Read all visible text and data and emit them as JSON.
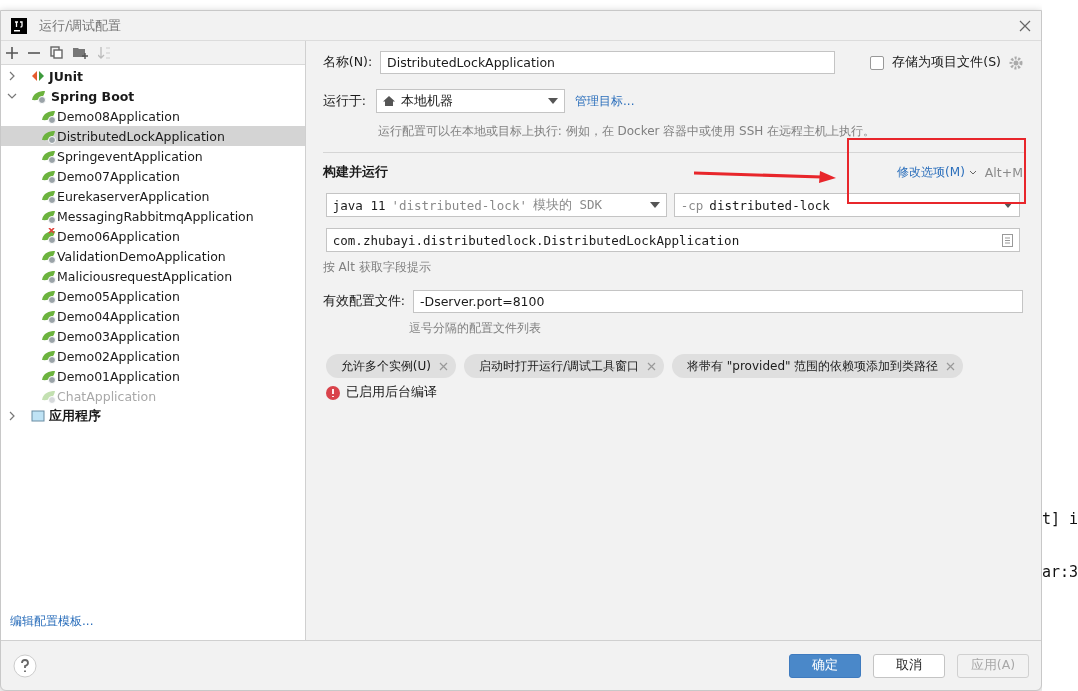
{
  "window": {
    "title": "运行/调试配置"
  },
  "tree": [
    {
      "label": "JUnit",
      "kind": "junit",
      "expanded": false,
      "selected": false
    },
    {
      "label": "Spring Boot",
      "kind": "spring",
      "expanded": true,
      "selected": false,
      "children": [
        {
          "label": "Demo08Application",
          "selected": false,
          "error": false,
          "dimmed": false
        },
        {
          "label": "DistributedLockApplication",
          "selected": true,
          "error": false,
          "dimmed": false
        },
        {
          "label": "SpringeventApplication",
          "selected": false,
          "error": false,
          "dimmed": false
        },
        {
          "label": "Demo07Application",
          "selected": false,
          "error": false,
          "dimmed": false
        },
        {
          "label": "EurekaserverApplication",
          "selected": false,
          "error": false,
          "dimmed": false
        },
        {
          "label": "MessagingRabbitmqApplication",
          "selected": false,
          "error": false,
          "dimmed": false
        },
        {
          "label": "Demo06Application",
          "selected": false,
          "error": true,
          "dimmed": false
        },
        {
          "label": "ValidationDemoApplication",
          "selected": false,
          "error": false,
          "dimmed": false
        },
        {
          "label": "MaliciousrequestApplication",
          "selected": false,
          "error": false,
          "dimmed": false
        },
        {
          "label": "Demo05Application",
          "selected": false,
          "error": false,
          "dimmed": false
        },
        {
          "label": "Demo04Application",
          "selected": false,
          "error": false,
          "dimmed": false
        },
        {
          "label": "Demo03Application",
          "selected": false,
          "error": false,
          "dimmed": false
        },
        {
          "label": "Demo02Application",
          "selected": false,
          "error": false,
          "dimmed": false
        },
        {
          "label": "Demo01Application",
          "selected": false,
          "error": false,
          "dimmed": false
        },
        {
          "label": "ChatApplication",
          "selected": false,
          "error": false,
          "dimmed": true
        }
      ]
    },
    {
      "label": "应用程序",
      "kind": "app",
      "expanded": false,
      "selected": false
    }
  ],
  "edit_templates_link": "编辑配置模板...",
  "form": {
    "name_label": "名称(N):",
    "name_value": "DistributedLockApplication",
    "store_label": "存储为项目文件(S)",
    "store_checked": false,
    "run_on_label": "运行于:",
    "run_on_value": "本地机器",
    "manage_targets": "管理目标...",
    "run_on_hint": "运行配置可以在本地或目标上执行: 例如，在 Docker 容器中或使用 SSH 在远程主机上执行。",
    "section_title": "构建并运行",
    "modify_options": "修改选项(M)",
    "modify_shortcut": "Alt+M",
    "sdk_java": "java 11",
    "sdk_module": "'distributed-lock'",
    "sdk_suffix": "模块的 SDK",
    "cp_flag": "-cp",
    "cp_value": "distributed-lock",
    "main_class": "com.zhubayi.distributedlock.DistributedLockApplication",
    "alt_hint": "按 Alt 获取字段提示",
    "profiles_label": "有效配置文件:",
    "profiles_value": "-Dserver.port=8100",
    "profiles_hint": "逗号分隔的配置文件列表",
    "chips": [
      "允许多个实例(U)",
      "启动时打开运行/调试工具窗口",
      "将带有 \"provided\" 范围的依赖项添加到类路径"
    ],
    "warning": "已启用后台编译"
  },
  "buttons": [
    {
      "label": "确定",
      "kind": "primary",
      "disabled": false
    },
    {
      "label": "取消",
      "kind": "normal",
      "disabled": false
    },
    {
      "label": "应用(A)",
      "kind": "normal",
      "disabled": true
    }
  ],
  "editor_fragments": [
    "t] i",
    "ar:3"
  ]
}
